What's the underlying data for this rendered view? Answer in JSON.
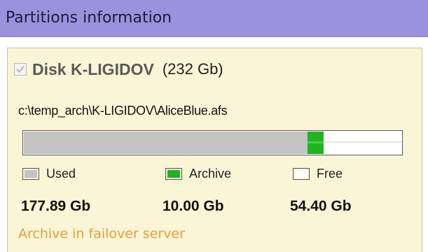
{
  "header": {
    "title": "Partitions information"
  },
  "disk": {
    "checked": true,
    "name": "Disk K-LIGIDOV",
    "size": "(232 Gb)",
    "path": "c:\\temp_arch\\K-LIGIDOV\\AliceBlue.afs"
  },
  "usage": {
    "used_fraction": 0.751,
    "archive_fraction": 0.042,
    "free_fraction": 0.207
  },
  "legend": {
    "used": {
      "label": "Used",
      "value": "177.89 Gb",
      "color": "#c3c3c3"
    },
    "archive": {
      "label": "Archive",
      "value": "10.00 Gb",
      "color": "#22b322"
    },
    "free": {
      "label": "Free",
      "value": "54.40 Gb",
      "color": "#ffffff"
    }
  },
  "status": {
    "text": "Archive in failover server",
    "color": "#e0a13a"
  },
  "colors": {
    "header_bg": "#9c91dd",
    "panel_bg": "#fbf5d8"
  }
}
